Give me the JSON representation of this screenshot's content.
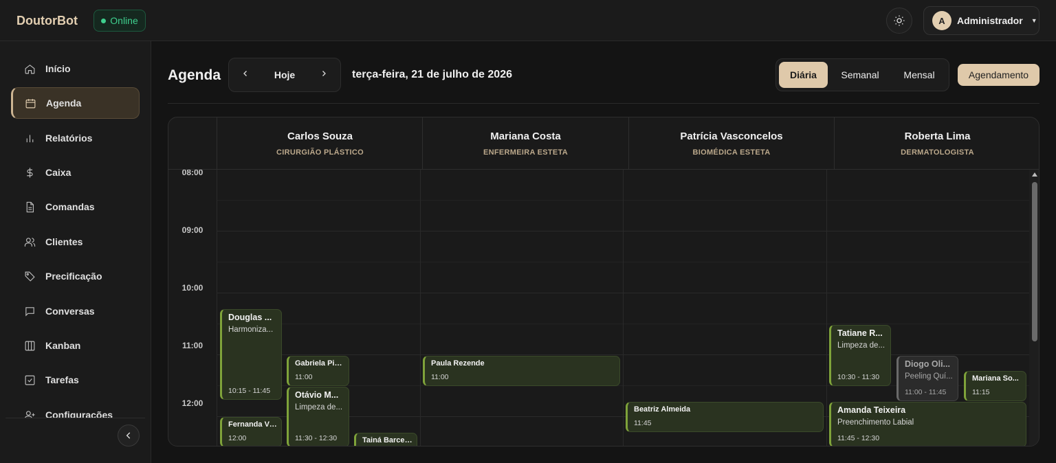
{
  "app": {
    "brand": "DoutorBot",
    "status": "Online"
  },
  "user": {
    "initial": "A",
    "name": "Administrador"
  },
  "sidebar": {
    "items": [
      {
        "label": "Início",
        "icon": "home-icon"
      },
      {
        "label": "Agenda",
        "icon": "calendar-icon"
      },
      {
        "label": "Relatórios",
        "icon": "bar-chart-icon"
      },
      {
        "label": "Caixa",
        "icon": "dollar-icon"
      },
      {
        "label": "Comandas",
        "icon": "document-icon"
      },
      {
        "label": "Clientes",
        "icon": "users-icon"
      },
      {
        "label": "Precificação",
        "icon": "tag-icon"
      },
      {
        "label": "Conversas",
        "icon": "chat-icon"
      },
      {
        "label": "Kanban",
        "icon": "kanban-icon"
      },
      {
        "label": "Tarefas",
        "icon": "checkbox-icon"
      },
      {
        "label": "Configurações",
        "icon": "user-plus-icon"
      }
    ],
    "active": "Agenda"
  },
  "header": {
    "title": "Agenda",
    "today": "Hoje",
    "date": "terça-feira, 21 de julho de 2026",
    "views": [
      "Diária",
      "Semanal",
      "Mensal"
    ],
    "active_view": "Diária",
    "new_button": "Agendamento"
  },
  "calendar": {
    "professionals": [
      {
        "name": "Carlos Souza",
        "role": "CIRURGIÃO PLÁSTICO"
      },
      {
        "name": "Mariana Costa",
        "role": "ENFERMEIRA ESTETA"
      },
      {
        "name": "Patrícia Vasconcelos",
        "role": "BIOMÉDICA ESTETA"
      },
      {
        "name": "Roberta Lima",
        "role": "DERMATOLOGISTA"
      }
    ],
    "hours": [
      "08:00",
      "09:00",
      "10:00",
      "11:00",
      "12:00"
    ],
    "events": [
      {
        "title": "Douglas ...",
        "service": "Harmoniza...",
        "time": "10:15 - 11:45"
      },
      {
        "title": "Gabriela Pires",
        "time": "11:00"
      },
      {
        "title": "Otávio M...",
        "service": "Limpeza de...",
        "time": "11:30 - 12:30"
      },
      {
        "title": "Fernanda Vi...",
        "time": "12:00"
      },
      {
        "title": "Tainá Barcel..."
      },
      {
        "title": "Paula Rezende",
        "time": "11:00"
      },
      {
        "title": "Beatriz Almeida",
        "time": "11:45"
      },
      {
        "title": "Tatiane R...",
        "service": "Limpeza de...",
        "time": "10:30 - 11:30"
      },
      {
        "title": "Diogo Oli...",
        "service": "Peeling Quí...",
        "time": "11:00 - 11:45"
      },
      {
        "title": "Mariana So...",
        "time": "11:15"
      },
      {
        "title": "Amanda Teixeira",
        "service": "Preenchimento Labial",
        "time": "11:45 - 12:30"
      }
    ]
  },
  "colors": {
    "accent": "#dfc9aa",
    "event_border": "#7fa33a",
    "online": "#3fcf8e"
  }
}
